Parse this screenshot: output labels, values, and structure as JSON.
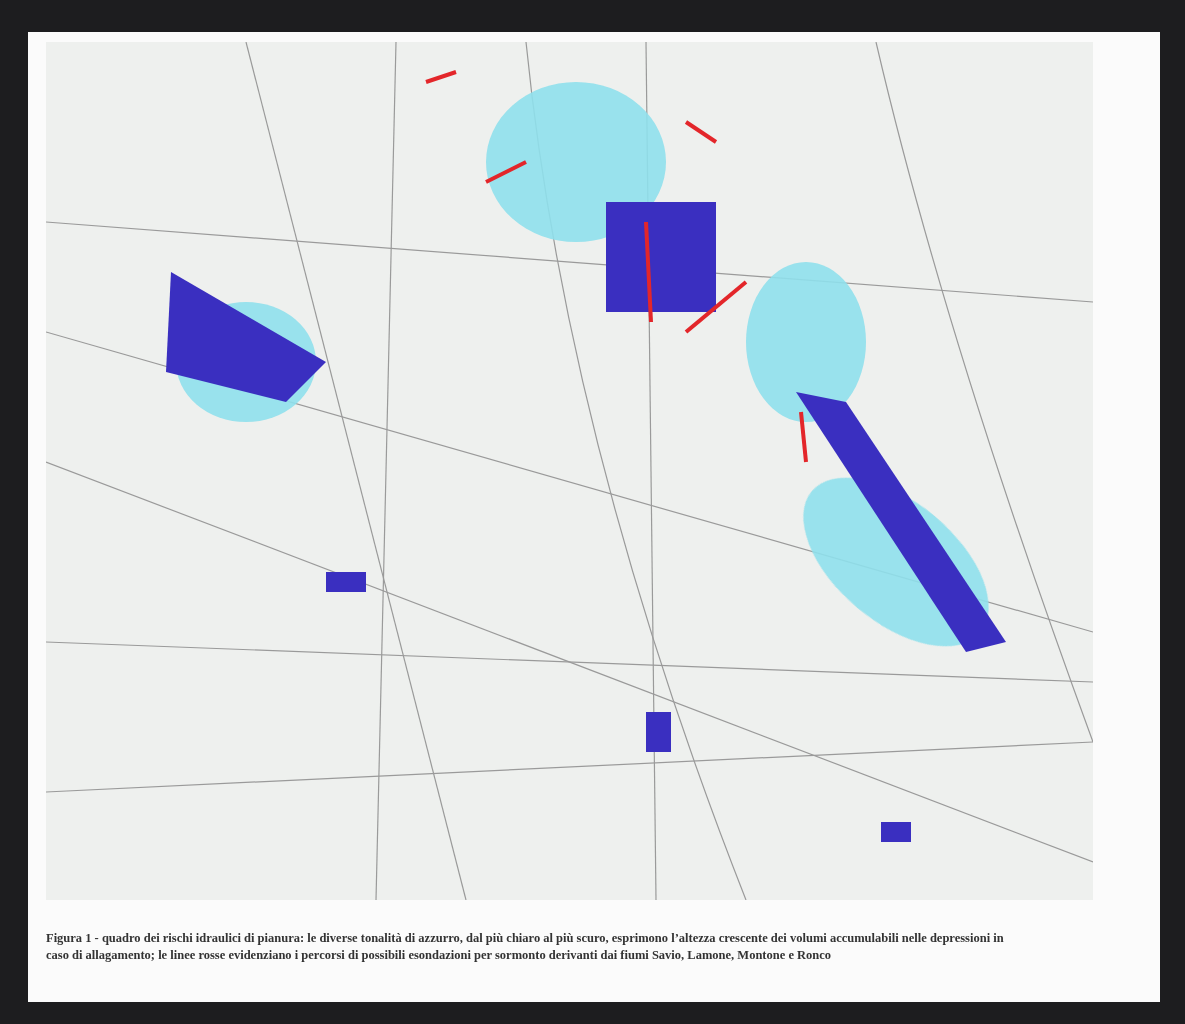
{
  "figure": {
    "caption": "Figura 1 - quadro dei rischi idraulici di pianura: le diverse tonalità di azzurro, dal più chiaro al più scuro, esprimono l’altezza crescente dei volumi accumulabili nelle depressioni in caso di allagamento; le linee rosse evidenziano i percorsi di possibili esondazioni per sormonto derivanti dai fiumi Savio, Lamone, Montone e Ronco"
  }
}
